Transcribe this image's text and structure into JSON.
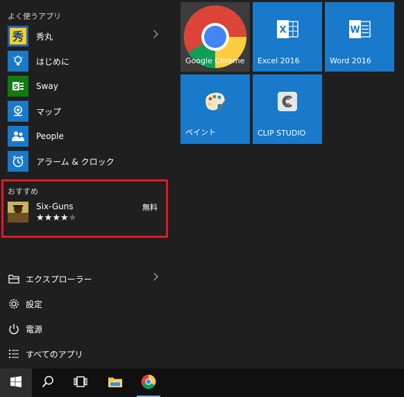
{
  "most_used": {
    "label": "よく使うアプリ",
    "items": [
      {
        "label": "秀丸",
        "icon": "hidemaru-icon"
      },
      {
        "label": "はじめに",
        "icon": "lightbulb-icon"
      },
      {
        "label": "Sway",
        "icon": "sway-icon"
      },
      {
        "label": "マップ",
        "icon": "maps-icon"
      },
      {
        "label": "People",
        "icon": "people-icon"
      },
      {
        "label": "アラーム & クロック",
        "icon": "alarm-clock-icon"
      }
    ]
  },
  "recommended": {
    "label": "おすすめ",
    "app_name": "Six-Guns",
    "price": "無料",
    "rating": 4,
    "rating_max": 5
  },
  "system": {
    "explorer": "エクスプローラー",
    "settings": "設定",
    "power": "電源",
    "all_apps": "すべてのアプリ"
  },
  "tiles": [
    {
      "label": "Google Chrome",
      "icon": "chrome-icon"
    },
    {
      "label": "Excel 2016",
      "icon": "excel-icon"
    },
    {
      "label": "Word 2016",
      "icon": "word-icon"
    },
    {
      "label": "ペイント",
      "icon": "paint-icon"
    },
    {
      "label": "CLIP STUDIO",
      "icon": "clip-studio-icon"
    }
  ],
  "colors": {
    "accent": "#1979ca",
    "highlight_border": "#e21a23",
    "menu_background": "#1f1f1f",
    "taskbar_background": "#101010"
  }
}
